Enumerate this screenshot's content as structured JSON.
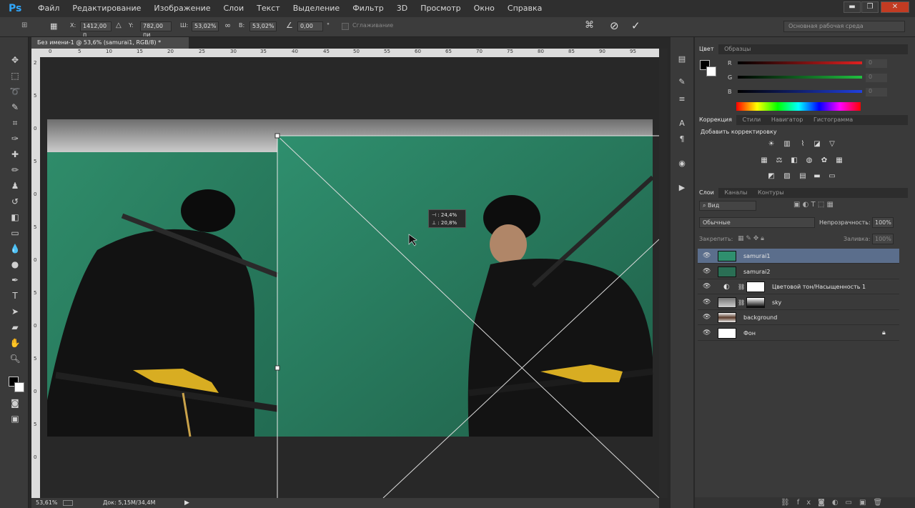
{
  "app": {
    "logo": "Ps"
  },
  "menu": [
    "Файл",
    "Редактирование",
    "Изображение",
    "Слои",
    "Текст",
    "Выделение",
    "Фильтр",
    "3D",
    "Просмотр",
    "Окно",
    "Справка"
  ],
  "window_controls": {
    "minimize": "▬",
    "restore": "❐",
    "close": "✕"
  },
  "options": {
    "x_label": "X:",
    "x_value": "1412,00 п",
    "y_label": "Y:",
    "y_value": "782,00 пи",
    "w_label": "Ш:",
    "w_value": "53,02%",
    "h_label": "В:",
    "h_value": "53,02%",
    "angle_value": "0,00",
    "degree": "°",
    "antialias_label": "Сглаживание",
    "workspace": "Основная рабочая среда"
  },
  "document": {
    "tab_title": "Без имени-1 @ 53,6% (samurai1, RGB/8) *",
    "ruler_ticks": [
      "0",
      "5",
      "10",
      "15",
      "20",
      "25",
      "30",
      "35",
      "40",
      "45",
      "50",
      "55",
      "60",
      "65",
      "70",
      "75",
      "80",
      "85",
      "90",
      "95"
    ],
    "ruler_v_ticks": [
      "2",
      "5",
      "0",
      "5",
      "0",
      "5",
      "0",
      "5",
      "0",
      "5",
      "0",
      "5",
      "0"
    ],
    "transform_readout": {
      "w": "⊣ : 24,4%",
      "h": "⊥ : 20,8%"
    }
  },
  "status": {
    "zoom": "53,61%",
    "doc": "Док: 5,15M/34,4M"
  },
  "color_panel": {
    "tabs": [
      "Цвет",
      "Образцы"
    ],
    "channels": [
      {
        "label": "R",
        "value": "0"
      },
      {
        "label": "G",
        "value": "0"
      },
      {
        "label": "B",
        "value": "0"
      }
    ],
    "colors": {
      "red": "#e02020",
      "green": "#20c040",
      "blue": "#2040e0"
    }
  },
  "adjust_panel": {
    "tabs": [
      "Коррекция",
      "Стили",
      "Навигатор",
      "Гистограмма"
    ],
    "title": "Добавить корректировку"
  },
  "layers_panel": {
    "tabs": [
      "Слои",
      "Каналы",
      "Контуры"
    ],
    "filter": "Вид",
    "blend_mode": "Обычные",
    "opacity_label": "Непрозрачность:",
    "opacity": "100%",
    "lock_label": "Закрепить:",
    "fill_label": "Заливка:",
    "fill": "100%",
    "layers": [
      {
        "name": "samurai1",
        "selected": true
      },
      {
        "name": "samurai2",
        "selected": false
      },
      {
        "name": "Цветовой тон/Насыщенность 1",
        "selected": false
      },
      {
        "name": "sky",
        "selected": false
      },
      {
        "name": "background",
        "selected": false
      },
      {
        "name": "Фон",
        "selected": false,
        "locked": true
      }
    ]
  }
}
